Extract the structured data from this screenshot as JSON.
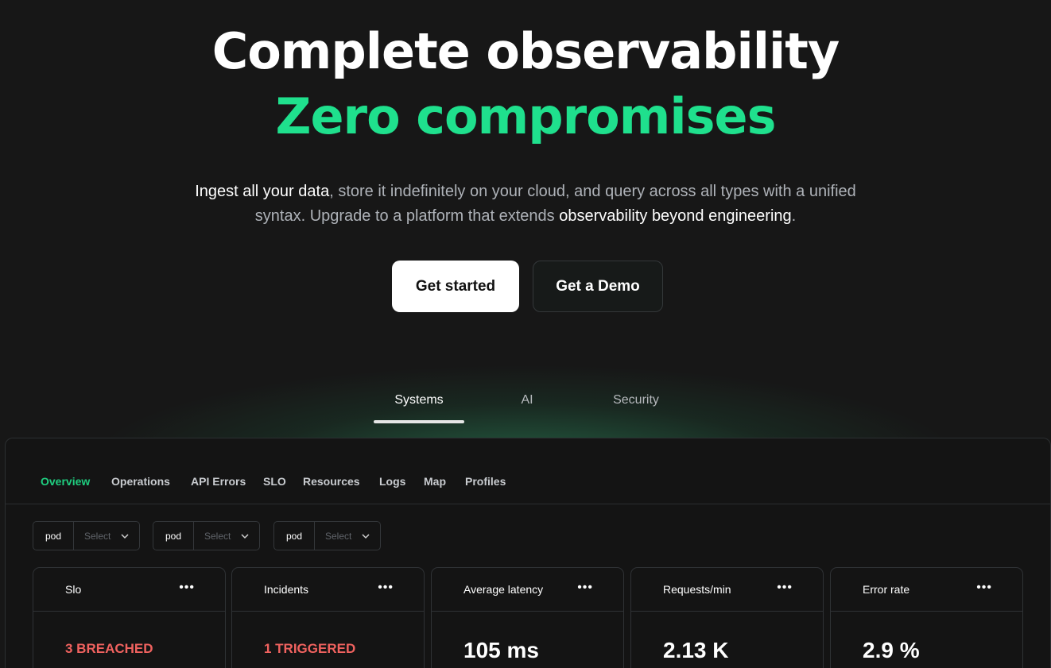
{
  "hero": {
    "title_line1": "Complete observability",
    "title_line2": "Zero compromises",
    "subtitle_part1": "Ingest all your data",
    "subtitle_part2": ", store it indefinitely on your cloud, and query across all types with a unified syntax. Upgrade to a platform that extends ",
    "subtitle_part3": "observability beyond engineering",
    "subtitle_part4": "."
  },
  "buttons": {
    "primary": "Get started",
    "secondary": "Get a Demo"
  },
  "tabs": {
    "systems": "Systems",
    "ai": "AI",
    "security": "Security",
    "active": "Systems"
  },
  "panel": {
    "nav": {
      "overview": "Overview",
      "operations": "Operations",
      "api_errors": "API Errors",
      "slo": "SLO",
      "resources": "Resources",
      "logs": "Logs",
      "map": "Map",
      "profiles": "Profiles",
      "active": "Overview"
    },
    "filters": [
      {
        "key": "pod",
        "placeholder": "Select"
      },
      {
        "key": "pod",
        "placeholder": "Select"
      },
      {
        "key": "pod",
        "placeholder": "Select"
      }
    ],
    "cards": [
      {
        "title": "Slo",
        "menu": "•••",
        "value": "3 BREACHED"
      },
      {
        "title": "Incidents",
        "menu": "•••",
        "value": "1 TRIGGERED"
      },
      {
        "title": "Average latency",
        "menu": "•••",
        "value": "105 ms"
      },
      {
        "title": "Requests/min",
        "menu": "•••",
        "value": "2.13 K"
      },
      {
        "title": "Error rate",
        "menu": "•••",
        "value": "2.9 %"
      }
    ]
  },
  "colors": {
    "accent_green": "#1fe08d",
    "nav_active_green": "#1fcf80",
    "alert_red": "#f0625f",
    "background": "#171717"
  }
}
